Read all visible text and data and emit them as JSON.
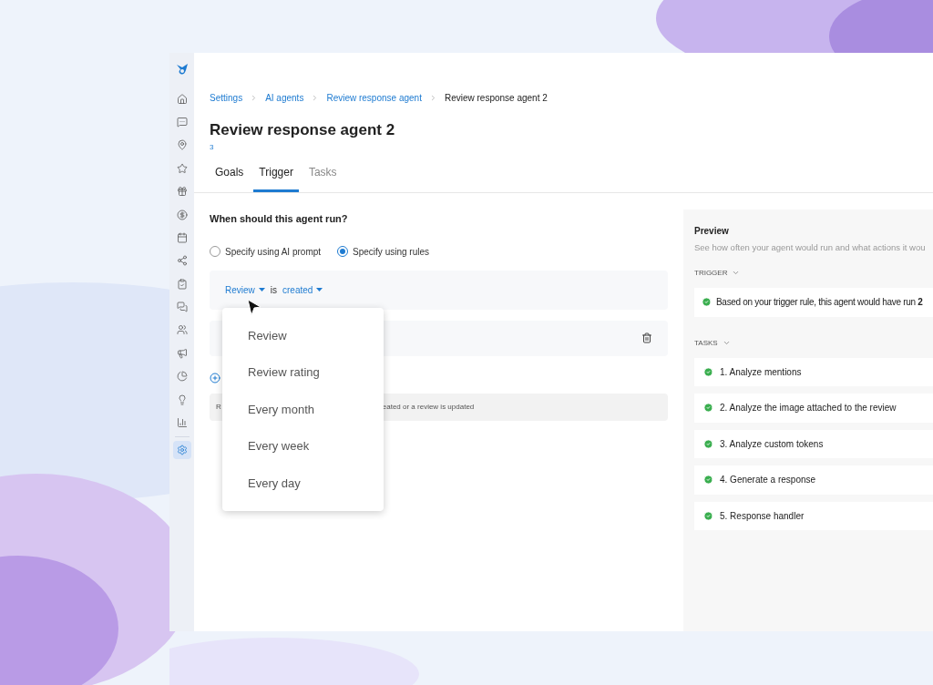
{
  "sidebar": {
    "items": [
      {
        "selected": false
      },
      {
        "selected": false
      },
      {
        "selected": false
      },
      {
        "selected": false
      },
      {
        "selected": false
      },
      {
        "selected": false
      },
      {
        "selected": false
      },
      {
        "selected": false
      },
      {
        "selected": false
      },
      {
        "selected": false
      },
      {
        "selected": false
      },
      {
        "selected": false
      },
      {
        "selected": false
      },
      {
        "selected": false
      },
      {
        "selected": false
      },
      {
        "selected": true
      }
    ]
  },
  "breadcrumb": [
    {
      "label": "Settings",
      "current": false
    },
    {
      "label": "AI agents",
      "current": false
    },
    {
      "label": "Review response agent",
      "current": false
    },
    {
      "label": "Review response agent 2",
      "current": true
    }
  ],
  "title": "Review response agent 2",
  "subtitle": "3",
  "tabs": [
    {
      "label": "Goals",
      "selected": false,
      "disabled": false
    },
    {
      "label": "Trigger",
      "selected": true,
      "disabled": false
    },
    {
      "label": "Tasks",
      "selected": false,
      "disabled": true
    }
  ],
  "question": "When should this agent run?",
  "modes": [
    {
      "label": "Specify using AI prompt",
      "selected": false
    },
    {
      "label": "Specify using rules",
      "selected": true
    }
  ],
  "rule": {
    "field": "Review",
    "operator": "is",
    "value": "created"
  },
  "dropdown": [
    {
      "label": "Review"
    },
    {
      "label": "Review rating"
    },
    {
      "label": "Every month"
    },
    {
      "label": "Every week"
    },
    {
      "label": "Every day"
    }
  ],
  "hint": {
    "start": "R",
    "end": "eated or a review is updated"
  },
  "preview": {
    "title": "Preview",
    "description": "See how often your agent would run and what actions it wou",
    "trigger_heading": "TRIGGER",
    "trigger_result": "Based on your trigger rule, this agent would have run **2**",
    "tasks_heading": "TASKS",
    "tasks": [
      {
        "label": "1. Analyze mentions",
        "done": true
      },
      {
        "label": "2. Analyze the image attached to the review",
        "done": true
      },
      {
        "label": "3. Analyze custom tokens",
        "done": true
      },
      {
        "label": "4. Generate a response",
        "done": true
      },
      {
        "label": "5. Response handler",
        "done": true
      }
    ]
  }
}
